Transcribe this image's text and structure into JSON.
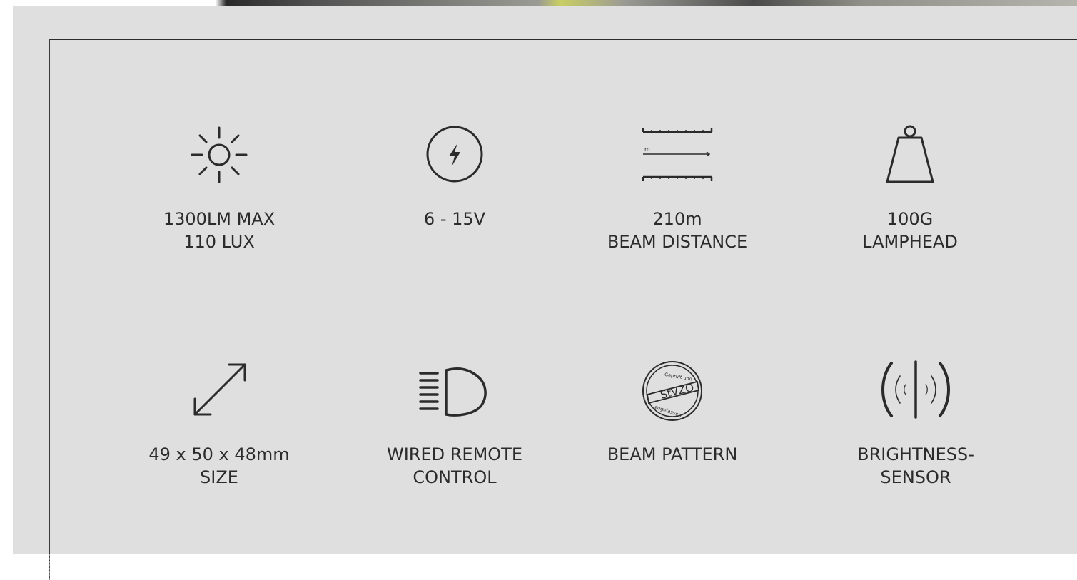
{
  "features": [
    {
      "icon": "sun-icon",
      "line1": "1300LM MAX",
      "line2": "110 LUX"
    },
    {
      "icon": "lightning-bolt-icon",
      "line1": "6 - 15V",
      "line2": ""
    },
    {
      "icon": "beam-distance-icon",
      "icon_text": "m",
      "line1": "210m",
      "line2": "BEAM DISTANCE"
    },
    {
      "icon": "weight-icon",
      "line1": "100G",
      "line2": "LAMPHEAD"
    },
    {
      "icon": "expand-arrows-icon",
      "line1": "49 x 50 x 48mm",
      "line2": "SIZE"
    },
    {
      "icon": "headlight-icon",
      "line1": "WIRED REMOTE",
      "line2": "CONTROL"
    },
    {
      "icon": "stvzo-seal-icon",
      "seal_top": "Geprüft und",
      "seal_main": "StVZO",
      "seal_bottom": "zugelassen",
      "line1": "BEAM PATTERN",
      "line2": ""
    },
    {
      "icon": "brightness-sensor-icon",
      "line1": "BRIGHTNESS-",
      "line2": "SENSOR"
    }
  ],
  "colors": {
    "panel": "#dfdfdf",
    "ink": "#2b2b2b"
  }
}
